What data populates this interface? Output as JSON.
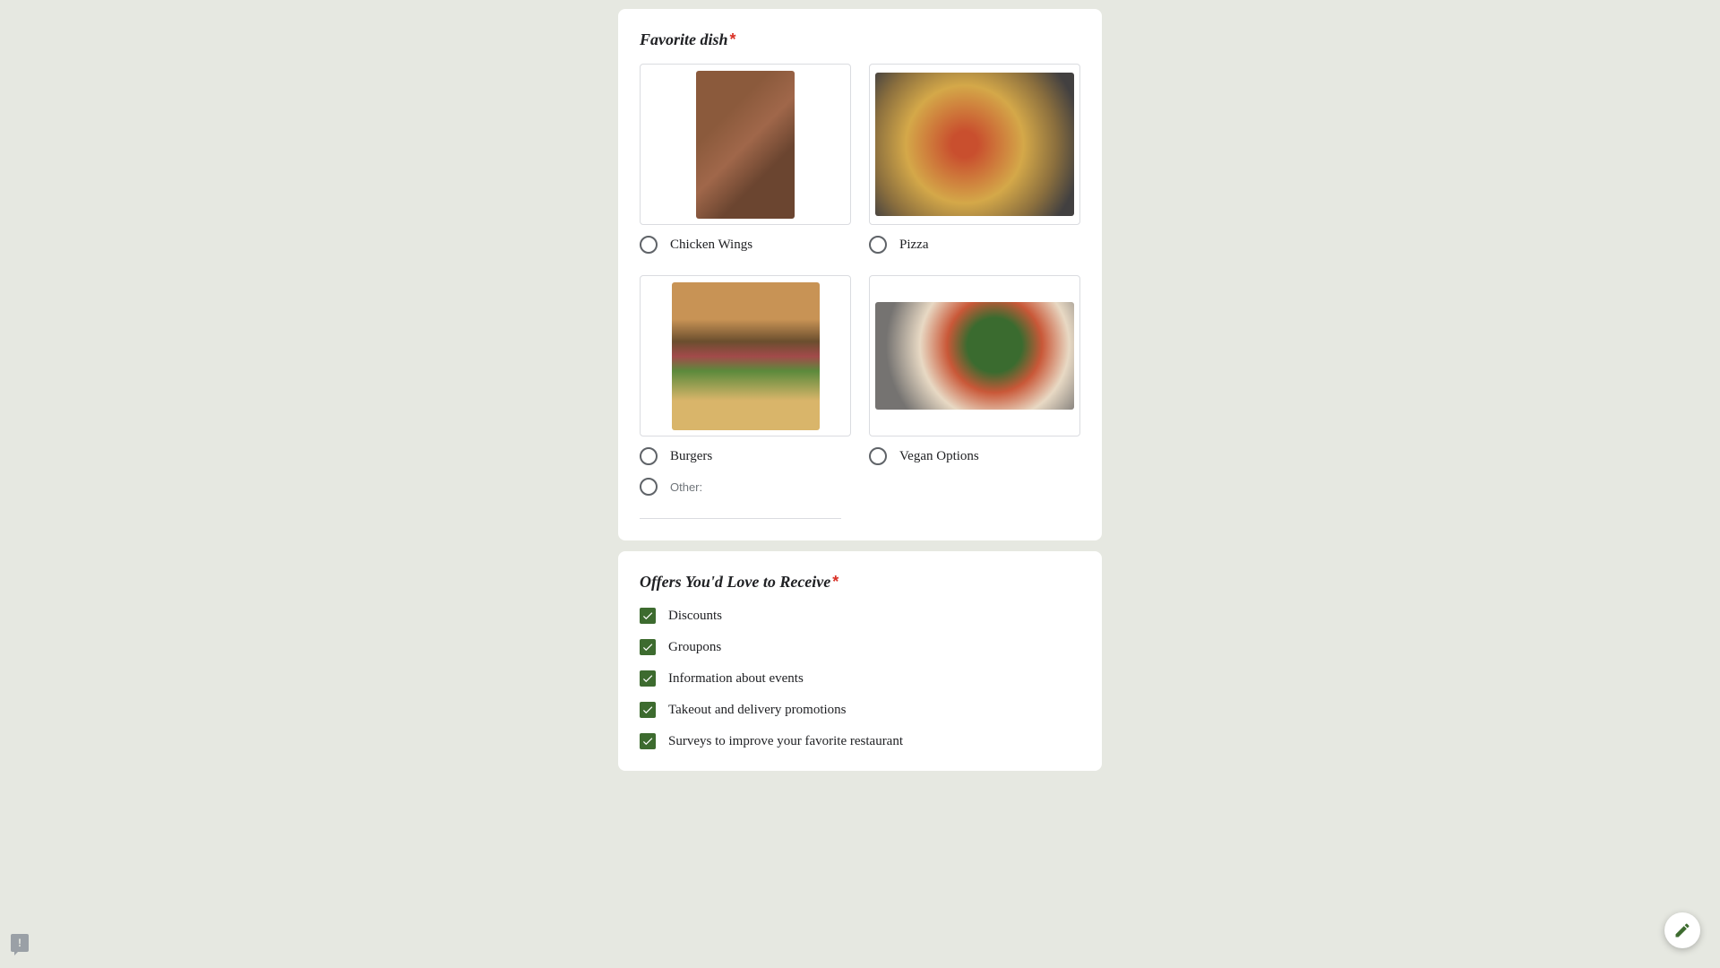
{
  "question1": {
    "title": "Favorite dish",
    "required_mark": "*",
    "options": [
      {
        "label": "Chicken Wings"
      },
      {
        "label": "Pizza"
      },
      {
        "label": "Burgers"
      },
      {
        "label": "Vegan Options"
      }
    ],
    "other_label": "Other:"
  },
  "question2": {
    "title": "Offers You'd Love to Receive",
    "required_mark": "*",
    "options": [
      {
        "label": "Discounts",
        "checked": true
      },
      {
        "label": "Groupons",
        "checked": true
      },
      {
        "label": "Information about events",
        "checked": true
      },
      {
        "label": "Takeout and delivery promotions",
        "checked": true
      },
      {
        "label": "Surveys to improve your favorite restaurant",
        "checked": true
      }
    ]
  }
}
